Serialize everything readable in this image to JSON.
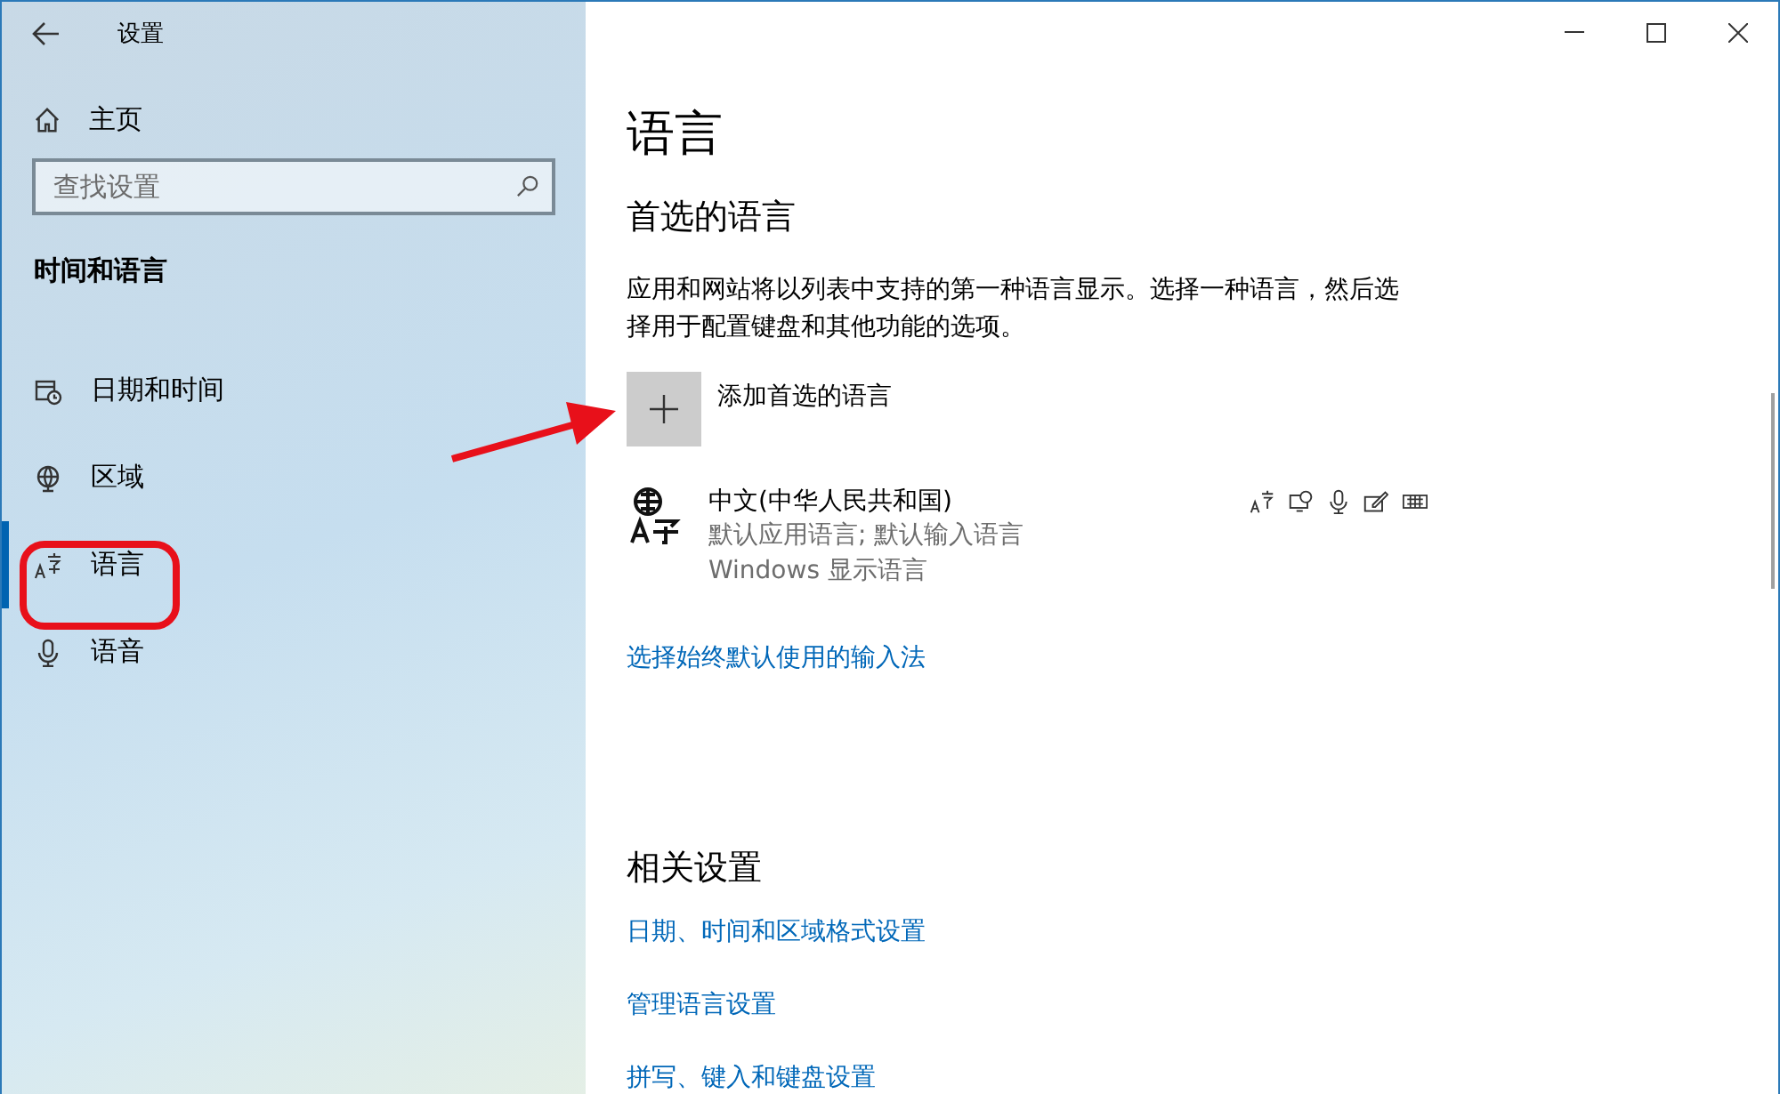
{
  "window": {
    "title": "设置"
  },
  "sidebar": {
    "home": "主页",
    "search": {
      "placeholder": "查找设置"
    },
    "section": "时间和语言",
    "items": [
      {
        "label": "日期和时间",
        "selected": false
      },
      {
        "label": "区域",
        "selected": false
      },
      {
        "label": "语言",
        "selected": true
      },
      {
        "label": "语音",
        "selected": false
      }
    ]
  },
  "main": {
    "title": "语言",
    "preferred": {
      "heading": "首选的语言",
      "description": "应用和网站将以列表中支持的第一种语言显示。选择一种语言，然后选择用于配置键盘和其他功能的选项。",
      "add_label": "添加首选的语言",
      "languages": [
        {
          "name": "中文(中华人民共和国)",
          "details": [
            "默认应用语言; 默认输入语言",
            "Windows 显示语言"
          ]
        }
      ],
      "link": "选择始终默认使用的输入法"
    },
    "related": {
      "heading": "相关设置",
      "links": [
        "日期、时间和区域格式设置",
        "管理语言设置",
        "拼写、键入和键盘设置"
      ]
    }
  }
}
